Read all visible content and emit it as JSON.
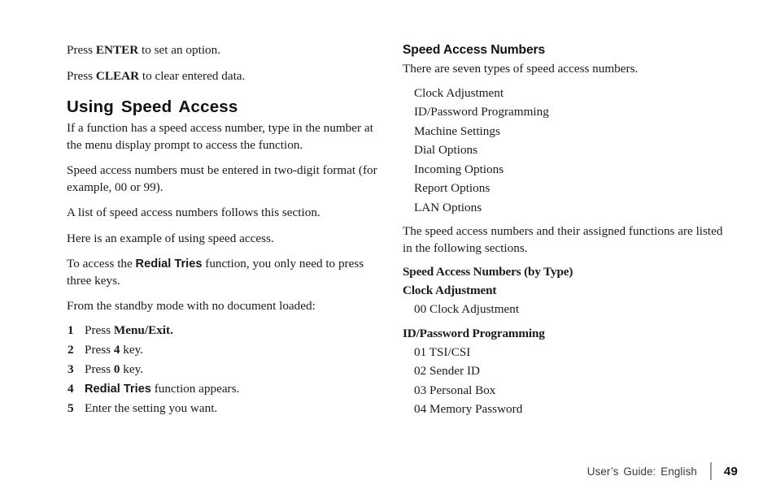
{
  "left_column": {
    "intro": [
      {
        "prefix": "Press ",
        "bold": "ENTER",
        "bold_style": "serif",
        "suffix": " to set an option."
      },
      {
        "prefix": "Press ",
        "bold": "CLEAR",
        "bold_style": "serif",
        "suffix": " to clear entered data."
      }
    ],
    "heading": "Using Speed Access",
    "paragraphs": [
      "If a function has a speed access number, type in the number at the menu display prompt to access the function.",
      "Speed access numbers must be entered in two-digit format (for example, 00 or 99).",
      "A list of speed access numbers follows this section.",
      "Here is an example of using speed access."
    ],
    "redial_para": {
      "prefix": "To access the ",
      "bold": "Redial Tries",
      "bold_style": "sans",
      "suffix": " function, you only need to press three keys."
    },
    "standby_line": "From the standby mode with no document loaded:",
    "steps": [
      {
        "num": "1",
        "prefix": "Press ",
        "bold": "Menu/Exit.",
        "bold_style": "serif",
        "suffix": ""
      },
      {
        "num": "2",
        "prefix": "Press ",
        "bold": "4",
        "bold_style": "serif",
        "suffix": " key."
      },
      {
        "num": "3",
        "prefix": "Press ",
        "bold": "0",
        "bold_style": "serif",
        "suffix": " key."
      },
      {
        "num": "4",
        "prefix": "",
        "bold": "Redial Tries",
        "bold_style": "sans",
        "suffix": " function appears."
      },
      {
        "num": "5",
        "prefix": "Enter the setting you want.",
        "bold": "",
        "bold_style": "serif",
        "suffix": ""
      }
    ]
  },
  "right_column": {
    "heading": "Speed Access Numbers",
    "intro": "There are seven types of speed access numbers.",
    "types": [
      "Clock Adjustment",
      "ID/Password Programming",
      "Machine Settings",
      "Dial Options",
      "Incoming Options",
      "Report Options",
      "LAN Options"
    ],
    "closing": "The speed access numbers and their assigned functions are listed in the following sections.",
    "by_type_heading": "Speed Access Numbers (by Type)",
    "sections": [
      {
        "title": "Clock Adjustment",
        "entries": [
          "00 Clock Adjustment"
        ]
      },
      {
        "title": "ID/Password Programming",
        "entries": [
          "01 TSI/CSI",
          "02 Sender ID",
          "03 Personal Box",
          "04 Memory Password"
        ]
      }
    ]
  },
  "footer": {
    "guide_label": "User’s Guide:  English",
    "page_number": "49"
  }
}
